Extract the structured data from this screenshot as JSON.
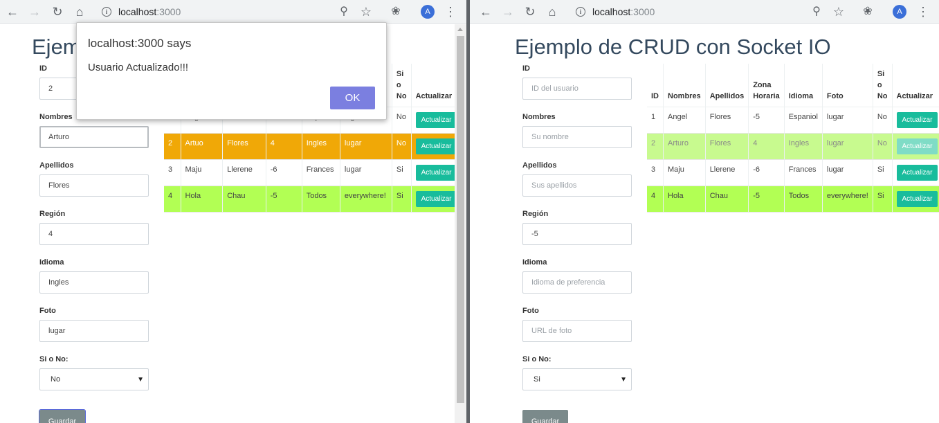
{
  "browser": {
    "host": "localhost",
    "port": ":3000",
    "avatar_letter": "A",
    "icons": [
      "back-icon",
      "forward-icon",
      "reload-icon",
      "home-icon",
      "info-icon",
      "zoom-icon",
      "star-icon",
      "extension-icon",
      "menu-icon"
    ]
  },
  "page_title": "Ejemplo de CRUD con Socket IO",
  "form_labels": {
    "id": "ID",
    "nombres": "Nombres",
    "apellidos": "Apellidos",
    "region": "Región",
    "idioma": "Idioma",
    "foto": "Foto",
    "sino": "Si o No:",
    "guardar": "Guardar"
  },
  "placeholders": {
    "id": "ID del usuario",
    "nombres": "Su nombre",
    "apellidos": "Sus apellidos",
    "idioma": "Idioma de preferencia",
    "foto": "URL de foto"
  },
  "table_headers": [
    "ID",
    "Nombres",
    "Apellidos",
    "Zona Horaria",
    "Idioma",
    "Foto",
    "Si o No",
    "Actualizar"
  ],
  "action_label": "Actualizar",
  "left": {
    "form": {
      "id": "2",
      "nombres": "Arturo",
      "apellidos": "Flores",
      "region": "4",
      "idioma": "Ingles",
      "foto": "lugar",
      "sino": "No"
    },
    "rows": [
      [
        "1",
        "Angel",
        "Flores",
        "-5",
        "Espaniol",
        "lugar",
        "No"
      ],
      [
        "2",
        "Artuo",
        "Flores",
        "4",
        "Ingles",
        "lugar",
        "No"
      ],
      [
        "3",
        "Maju",
        "Llerene",
        "-6",
        "Frances",
        "lugar",
        "Si"
      ],
      [
        "4",
        "Hola",
        "Chau",
        "-5",
        "Todos",
        "everywhere!",
        "Si"
      ]
    ]
  },
  "right": {
    "form": {
      "id": "",
      "nombres": "",
      "apellidos": "",
      "region": "-5",
      "idioma": "",
      "foto": "",
      "sino": "Si"
    },
    "rows": [
      [
        "1",
        "Angel",
        "Flores",
        "-5",
        "Espaniol",
        "lugar",
        "No"
      ],
      [
        "2",
        "Arturo",
        "Flores",
        "4",
        "Ingles",
        "lugar",
        "No"
      ],
      [
        "3",
        "Maju",
        "Llerene",
        "-6",
        "Frances",
        "lugar",
        "Si"
      ],
      [
        "4",
        "Hola",
        "Chau",
        "-5",
        "Todos",
        "everywhere!",
        "Si"
      ]
    ]
  },
  "dialog": {
    "title": "localhost:3000 says",
    "message": "Usuario Actualizado!!!",
    "ok_label": "OK"
  },
  "colors": {
    "row_highlight_orange": "#f0a807",
    "row_highlight_lime": "#b2ff54",
    "row_highlight_faded": "#c8fa8f",
    "action_button": "#18bc9c",
    "guardar_button": "#7b8a8b",
    "ok_button": "#7b7fe0"
  }
}
